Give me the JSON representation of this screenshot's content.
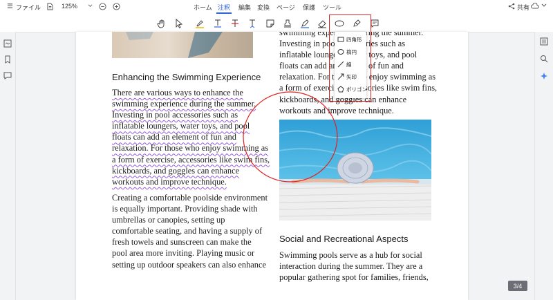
{
  "topbar": {
    "file_menu": "ファイル",
    "zoom_value": "125%",
    "tabs": [
      "ホーム",
      "注釈",
      "編集",
      "変換",
      "ページ",
      "保護",
      "ツール"
    ],
    "share_label": "共有"
  },
  "toolbar": {
    "tools": [
      "hand-icon",
      "select-arrow-icon",
      "highlight-icon",
      "text-underline-icon",
      "strikethrough-icon",
      "text-insert-icon",
      "sticky-note-icon",
      "stamp-icon",
      "pen-icon",
      "eraser-icon",
      "shape-ellipse-icon",
      "measure-pen-icon",
      "comment-icon"
    ]
  },
  "shape_menu": {
    "items": [
      "四角形",
      "楕円",
      "線",
      "矢印",
      "ポリゴン"
    ]
  },
  "document": {
    "right_top_lines": [
      "swimming experience during the summer.",
      "Investing in pool accessories such as",
      "inflatable loungers, water toys, and pool",
      "floats can add an element of fun and",
      "relaxation. For those who enjoy swimming as",
      "a form of exercise, accessories like swim fins,",
      "kickboards, and goggles can enhance",
      "workouts and improve technique."
    ],
    "heading_left": "Enhancing the Swimming Experience",
    "para1_lines": [
      "There are various ways to enhance the",
      "swimming experience during the summer.",
      "Investing in pool accessories such as",
      "inflatable loungers, water toys, and pool",
      "floats can add an element of fun and",
      "relaxation. For those who enjoy swimming as",
      "a form of exercise, accessories like swim fins,",
      "kickboards, and goggles can enhance",
      "workouts and improve technique."
    ],
    "para2_lines": [
      "Creating a comfortable poolside environment",
      "is equally important. Providing shade with",
      "umbrellas or canopies, setting up",
      "comfortable seating, and having a supply of",
      "fresh towels and sunscreen can make the",
      "pool area more inviting. Playing music or",
      "setting up outdoor speakers can also enhance"
    ],
    "heading_right": "Social and Recreational Aspects",
    "para3_lines": [
      "Swimming pools serve as a hub for social",
      "interaction during the summer. They are a",
      "popular gathering spot for families, friends,"
    ]
  },
  "page_indicator": "3/4",
  "colors": {
    "accent": "#2b63d9",
    "annotation_red": "#e02020",
    "squiggle": "#9b59d9"
  }
}
